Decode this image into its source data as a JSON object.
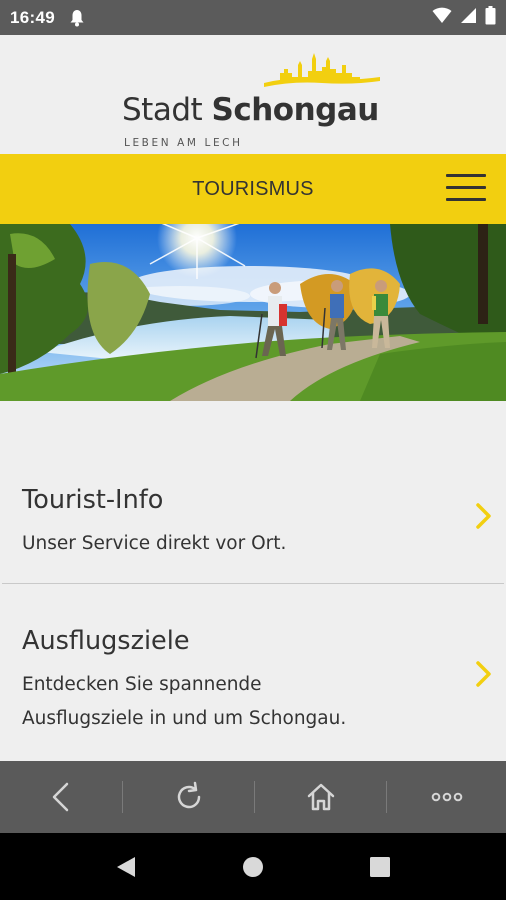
{
  "status_bar": {
    "time": "16:49",
    "icons": [
      "notification-bell-icon",
      "wifi-icon",
      "cellular-signal-icon",
      "battery-icon"
    ]
  },
  "logo": {
    "word_light": "Stadt ",
    "word_bold": "Schongau",
    "tagline": "LEBEN AM LECH",
    "skyline_color": "#f2cf10"
  },
  "navbar": {
    "title": "TOURISMUS",
    "background": "#f2cf10",
    "menu_icon": "hamburger-menu-icon"
  },
  "hero": {
    "description_icon": "hero-image"
  },
  "items": [
    {
      "title": "Tourist-Info",
      "desc_line1": "Unser Service direkt vor Ort.",
      "desc_line2": "",
      "icon": "chevron-right-icon"
    },
    {
      "title": "Ausflugsziele",
      "desc_line1": "Entdecken Sie spannende",
      "desc_line2": "Ausflugsziele in und um Schongau.",
      "icon": "chevron-right-icon"
    }
  ],
  "toolbar": {
    "icons": [
      "back-icon",
      "reload-icon",
      "home-icon",
      "more-icon"
    ]
  },
  "system_nav": {
    "icons": [
      "system-back-icon",
      "system-home-icon",
      "system-recents-icon"
    ]
  },
  "colors": {
    "accent": "#f2cf10",
    "text": "#333333",
    "toolbar": "#5a5a5a"
  }
}
